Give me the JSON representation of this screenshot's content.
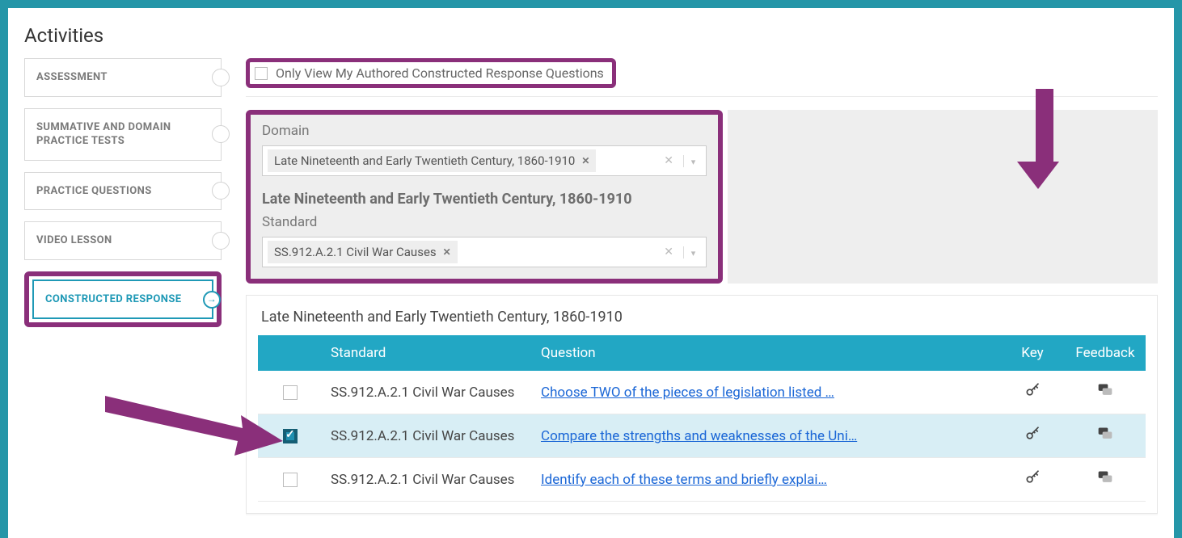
{
  "pageTitle": "Activities",
  "sidebar": {
    "items": [
      {
        "label": "ASSESSMENT"
      },
      {
        "label": "SUMMATIVE AND DOMAIN PRACTICE TESTS"
      },
      {
        "label": "PRACTICE QUESTIONS"
      },
      {
        "label": "VIDEO LESSON"
      },
      {
        "label": "CONSTRUCTED RESPONSE"
      }
    ]
  },
  "filterCheckboxLabel": "Only View My Authored Constructed Response Questions",
  "filters": {
    "domainLabel": "Domain",
    "domainChip": "Late Nineteenth and Early Twentieth Century, 1860-1910",
    "domainHeading": "Late Nineteenth and Early Twentieth Century, 1860-1910",
    "standardLabel": "Standard",
    "standardChip": "SS.912.A.2.1 Civil War Causes"
  },
  "results": {
    "title": "Late Nineteenth and Early Twentieth Century, 1860-1910",
    "headers": {
      "standard": "Standard",
      "question": "Question",
      "key": "Key",
      "feedback": "Feedback"
    },
    "rows": [
      {
        "checked": false,
        "standard": "SS.912.A.2.1 Civil War Causes",
        "question": "Choose TWO of the pieces of legislation listed …"
      },
      {
        "checked": true,
        "standard": "SS.912.A.2.1 Civil War Causes",
        "question": "Compare the strengths and weaknesses of the Uni…"
      },
      {
        "checked": false,
        "standard": "SS.912.A.2.1 Civil War Causes",
        "question": "Identify each of these terms and briefly explai…"
      }
    ]
  },
  "colors": {
    "highlight": "#8a2f7a",
    "primary": "#22a7c4",
    "link": "#1a66d6"
  }
}
